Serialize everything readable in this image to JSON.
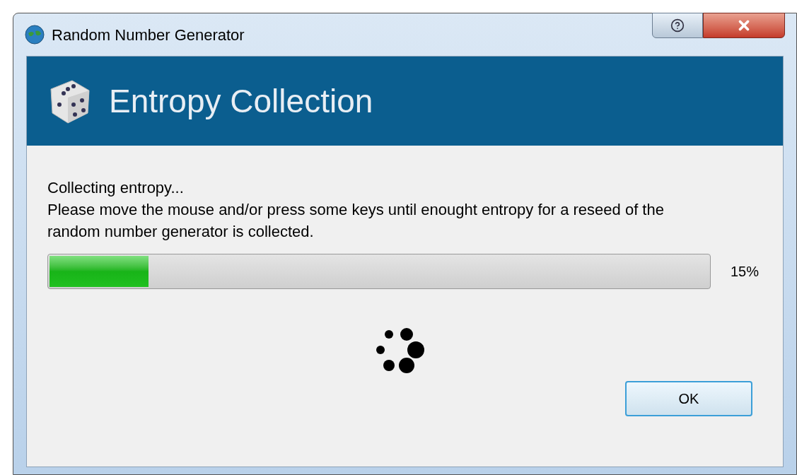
{
  "window": {
    "title": "Random Number Generator"
  },
  "header": {
    "title": "Entropy Collection"
  },
  "message": {
    "status": "Collecting entropy...",
    "instructions": "Please move the mouse and/or press some keys until enought entropy for a reseed of the random number generator is collected."
  },
  "progress": {
    "level": 0.15,
    "reading": "15%"
  },
  "buttons": [
    {
      "label": "OK",
      "default": true
    }
  ]
}
